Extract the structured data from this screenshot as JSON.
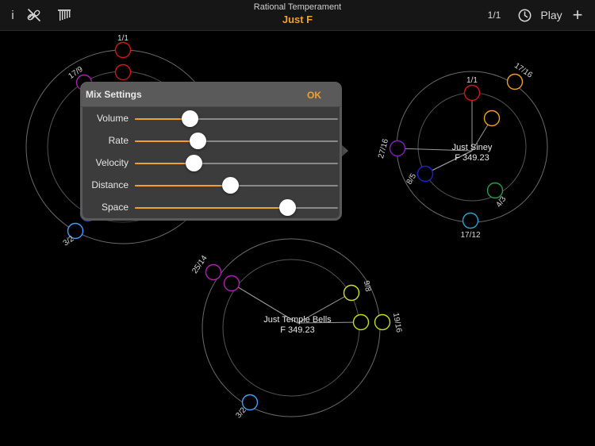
{
  "header": {
    "subtitle": "Rational Temperament",
    "title": "Just F",
    "info_label": "i",
    "ratio_display": "1/1",
    "play_label": "Play",
    "add_label": "+"
  },
  "mix_settings": {
    "title": "Mix Settings",
    "ok_label": "OK",
    "sliders": [
      {
        "label": "Volume",
        "value": 0.27
      },
      {
        "label": "Rate",
        "value": 0.31
      },
      {
        "label": "Velocity",
        "value": 0.29
      },
      {
        "label": "Distance",
        "value": 0.47
      },
      {
        "label": "Space",
        "value": 0.75
      }
    ]
  },
  "wheels": [
    {
      "name": "left-wheel",
      "title": "",
      "subtitle": "",
      "notes": [
        {
          "ratio": "1/1",
          "color": "#d01818"
        },
        {
          "ratio": "",
          "color": "#d01818"
        },
        {
          "ratio": "17/9",
          "color": "#b020b0"
        },
        {
          "ratio": "",
          "color": "#3070ff"
        },
        {
          "ratio": "3/2",
          "color": "#40a0ff"
        }
      ]
    },
    {
      "name": "right-wheel",
      "title": "Just Siney",
      "subtitle": "F 349.23",
      "notes": [
        {
          "ratio": "1/1",
          "color": "#d01818"
        },
        {
          "ratio": "17/16",
          "color": "#f0a020"
        },
        {
          "ratio": "",
          "color": "#f0a020"
        },
        {
          "ratio": "27/16",
          "color": "#8020c0"
        },
        {
          "ratio": "8/5",
          "color": "#2020d0"
        },
        {
          "ratio": "4/3",
          "color": "#20a050"
        },
        {
          "ratio": "17/12",
          "color": "#30a0d0"
        }
      ]
    },
    {
      "name": "bottom-wheel",
      "title": "Just Temple Bells",
      "subtitle": "F 349.23",
      "notes": [
        {
          "ratio": "25/14",
          "color": "#b020b0"
        },
        {
          "ratio": "",
          "color": "#b020b0"
        },
        {
          "ratio": "9/8",
          "color": "#d0e020"
        },
        {
          "ratio": "",
          "color": "#c0e020"
        },
        {
          "ratio": "19/16",
          "color": "#c0e020"
        },
        {
          "ratio": "3/2",
          "color": "#40a0ff"
        }
      ]
    }
  ],
  "icons": {
    "no_link": "link-slash-icon",
    "instrument": "chimes-icon",
    "history": "clock-icon"
  }
}
